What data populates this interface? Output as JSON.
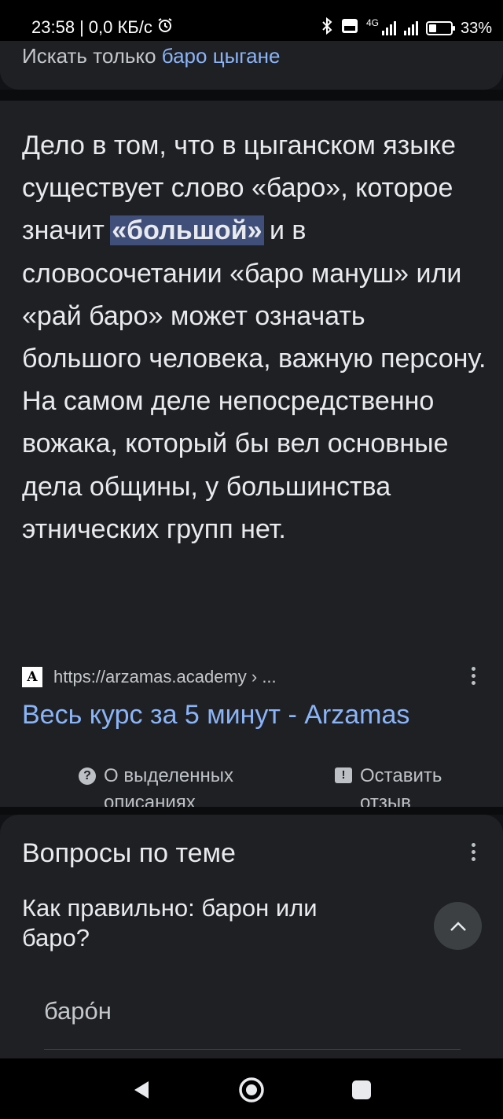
{
  "status_bar": {
    "time": "23:58",
    "speed": "0,0 КБ/с",
    "network": "4G",
    "battery": "33%",
    "battery_level": 0.33
  },
  "top_card": {
    "prefix": "Искать только",
    "query": "баро цыгане"
  },
  "snippet": {
    "before": "Дело в том, что в цыганском языке существует слово «баро», которое значит ",
    "highlight": "«большой»",
    "after": " и в словосочетании «баро мануш» или «рай баро» может означать большого человека, важную персону. На самом деле непосредственно вожака, который бы вел основные дела общины, у большинства этнических групп нет."
  },
  "source": {
    "logo_letter": "A",
    "url": "https://arzamas.academy › ...",
    "title": "Весь курс за 5 минут - Arzamas"
  },
  "feedback": {
    "about_label": "О выделенных описаниях",
    "leave_label": "Оставить отзыв"
  },
  "related": {
    "heading": "Вопросы по теме",
    "question": "Как правильно: барон или баро?",
    "answer": "баро́н"
  },
  "colors": {
    "background": "#121317",
    "card": "#1f2024",
    "link": "#8ab4f8",
    "highlight": "#3f4f7a"
  }
}
